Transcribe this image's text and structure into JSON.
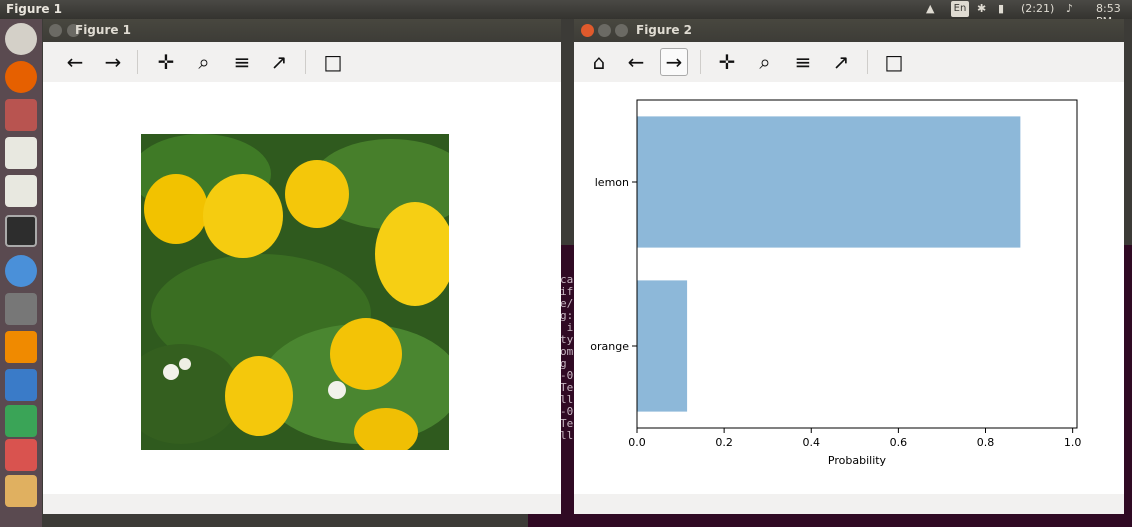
{
  "top_panel": {
    "app_title": "Figure 1",
    "keyboard_layout": "En",
    "battery_text": "(2:21)",
    "clock": "8:53 PM"
  },
  "launcher_icons": [
    "ubuntu-dash-icon",
    "firefox-icon",
    "files-icon",
    "text-editor-icon",
    "text-editor-icon",
    "terminal-icon",
    "chromium-icon",
    "system-monitor-icon",
    "vlc-icon",
    "document-viewer-icon",
    "spreadsheet-icon",
    "presentation-icon",
    "software-icon"
  ],
  "figure1": {
    "title": "Figure 1",
    "image_alt": "lemons on tree"
  },
  "figure2": {
    "title": "Figure 2"
  },
  "toolbar_icons": [
    "home-icon",
    "back-arrow-icon",
    "forward-arrow-icon",
    "pan-icon",
    "zoom-icon",
    "configure-subplots-icon",
    "edit-axes-icon",
    "save-icon"
  ],
  "chart_data": {
    "type": "bar",
    "orientation": "horizontal",
    "categories": [
      "lemon",
      "orange"
    ],
    "values": [
      0.88,
      0.115
    ],
    "xlabel": "Probability",
    "ylabel": "",
    "title": "",
    "xlim": [
      0,
      1.01
    ],
    "xticks": [
      "0.0",
      "0.2",
      "0.4",
      "0.6",
      "0.8",
      "1.0"
    ],
    "bar_color": "#8db8d9",
    "grid": false
  },
  "terminal_lines": [
    "ca",
    "if",
    "e/",
    "g:",
    " i",
    "ty",
    "om",
    "g",
    "-0",
    "Te",
    "ll",
    "-0",
    "Te",
    "ll"
  ]
}
